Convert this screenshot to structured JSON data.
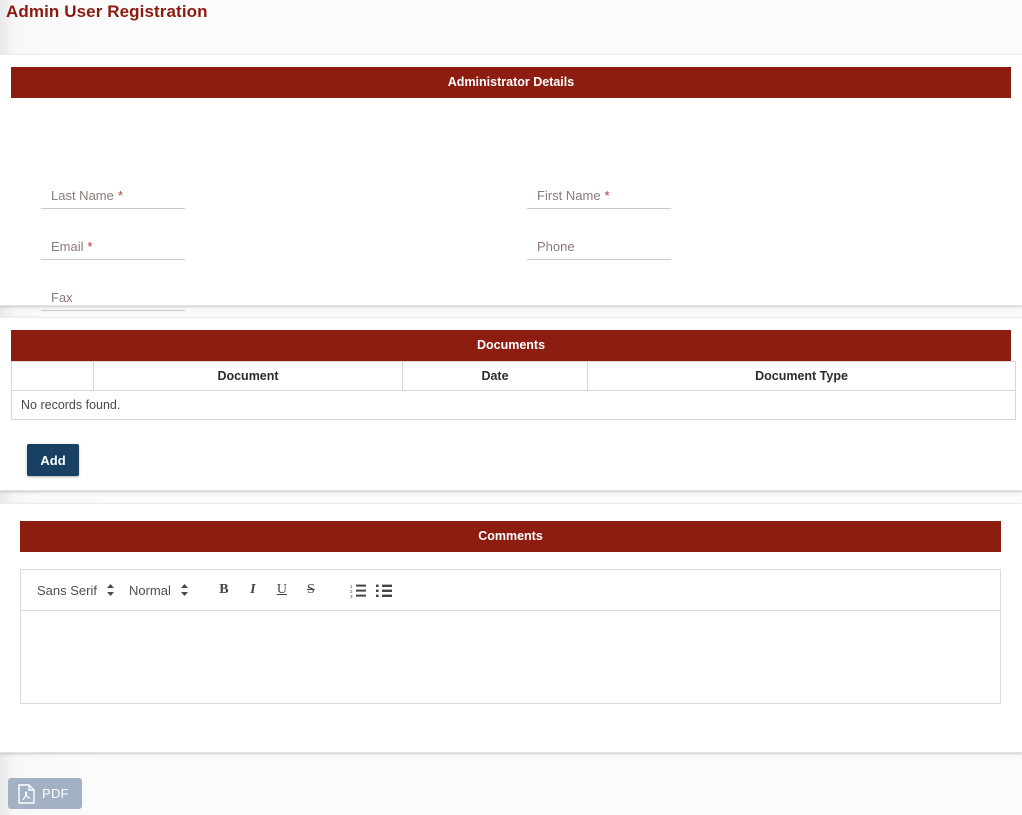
{
  "page": {
    "title": "Admin User Registration",
    "accent_color": "#8e1d11",
    "title_color": "#8b1a10",
    "background": "#fbfbfb"
  },
  "admin_details": {
    "header": "Administrator Details",
    "fields": [
      {
        "label": "Last Name",
        "required_mark": "*",
        "value": "",
        "placeholder": "Last Name"
      },
      {
        "label": "First Name",
        "required_mark": "*",
        "value": "",
        "placeholder": "First Name"
      },
      {
        "label": "Email",
        "required_mark": "*",
        "value": "",
        "placeholder": "Email"
      },
      {
        "label": "Phone",
        "required_mark": "",
        "value": "",
        "placeholder": "Phone"
      },
      {
        "label": "Fax",
        "required_mark": "",
        "value": "",
        "placeholder": "Fax"
      }
    ]
  },
  "documents": {
    "header": "Documents",
    "columns": [
      "",
      "Document",
      "Date",
      "Document Type"
    ],
    "rows": [],
    "empty_message": "No records found.",
    "add_button": {
      "label": "Add",
      "color": "#184062"
    }
  },
  "comments": {
    "header": "Comments",
    "toolbar": {
      "font_family": "Sans Serif",
      "font_size": "Normal",
      "bold": "B",
      "italic": "I",
      "underline": "U",
      "strike": "S",
      "ordered_list": "ordered-list",
      "unordered_list": "unordered-list"
    },
    "body_value": ""
  },
  "footer": {
    "pdf_button": {
      "label": "PDF",
      "icon": "pdf-file-icon",
      "color": "#a2b2c4"
    }
  }
}
